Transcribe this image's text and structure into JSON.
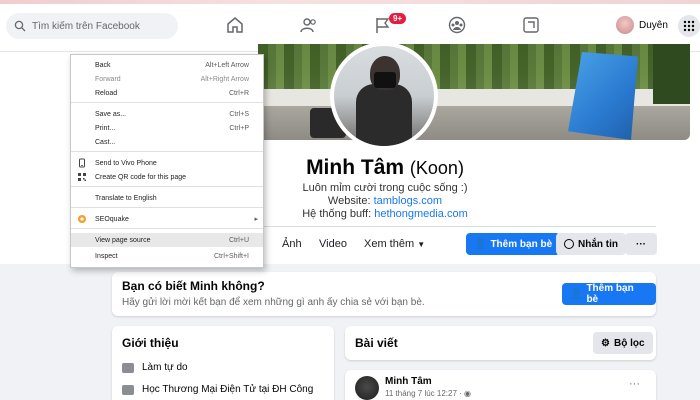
{
  "nav": {
    "search_placeholder": "Tìm kiếm trên Facebook",
    "notif_badge": "9+",
    "user_name": "Duyên",
    "icons": [
      "home-icon",
      "friends-icon",
      "flag-icon",
      "groups-icon",
      "gaming-icon"
    ]
  },
  "profile": {
    "name": "Minh Tâm",
    "nickname": "(Koon)",
    "bio_line": "Luôn mỉm cười trong cuộc sống :)",
    "website_label": "Website:",
    "website": "tamblogs.com",
    "system_label": "Hệ thống buff:",
    "system_link": "hethongmedia.com"
  },
  "tabs": {
    "photos": "Ảnh",
    "video": "Video",
    "more": "Xem thêm",
    "add_friend": "Thêm bạn bè",
    "message": "Nhắn tin",
    "more_options": "···"
  },
  "know_card": {
    "title": "Bạn có biết Minh không?",
    "subtitle": "Hãy gửi lời mời kết bạn để xem những gì anh ấy chia sẻ với bạn bè.",
    "button": "Thêm bạn bè"
  },
  "intro": {
    "title": "Giới thiệu",
    "items": [
      "Làm tự do",
      "Học Thương Mại Điện Tử tại ĐH Công"
    ]
  },
  "posts": {
    "title": "Bài viết",
    "filter": "Bộ lọc",
    "post_author": "Minh Tâm",
    "post_time": "11 tháng 7 lúc 12:27 · ",
    "post_more": "···"
  },
  "context_menu": {
    "items": [
      {
        "label": "Back",
        "key": "Alt+Left Arrow"
      },
      {
        "label": "Forward",
        "key": "Alt+Right Arrow"
      },
      {
        "label": "Reload",
        "key": "Ctrl+R"
      },
      {
        "label": "Save as...",
        "key": "Ctrl+S"
      },
      {
        "label": "Print...",
        "key": "Ctrl+P"
      },
      {
        "label": "Cast...",
        "key": ""
      },
      {
        "label": "Send to Vivo Phone",
        "key": ""
      },
      {
        "label": "Create QR code for this page",
        "key": ""
      },
      {
        "label": "Translate to English",
        "key": ""
      },
      {
        "label": "SEOquake",
        "key": ""
      },
      {
        "label": "View page source",
        "key": "Ctrl+U"
      },
      {
        "label": "Inspect",
        "key": "Ctrl+Shift+I"
      }
    ]
  },
  "colors": {
    "accent": "#1877f2",
    "badge": "#e41e3f"
  }
}
